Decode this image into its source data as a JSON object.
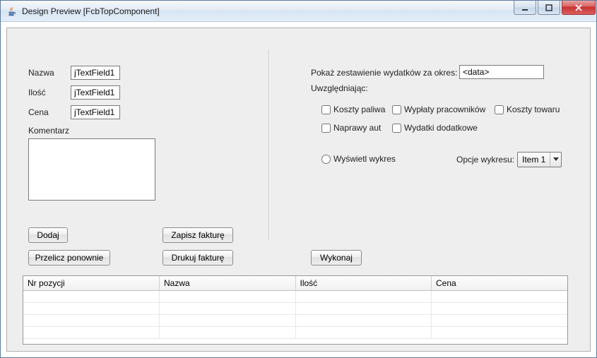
{
  "window": {
    "title": "Design Preview [FcbTopComponent]"
  },
  "left": {
    "labels": {
      "nazwa": "Nazwa",
      "ilosc": "Ilość",
      "cena": "Cena",
      "komentarz": "Komentarz"
    },
    "fields": {
      "nazwa": "jTextField1",
      "ilosc": "jTextField1",
      "cena": "jTextField1",
      "komentarz": ""
    },
    "buttons": {
      "dodaj": "Dodaj",
      "zapisz": "Zapisz fakturę",
      "przelicz": "Przelicz ponownie",
      "drukuj": "Drukuj fakturę"
    }
  },
  "right": {
    "period_label": "Pokaż zestawienie wydatków za okres:",
    "period_value": "<data>",
    "consider_label": "Uwzględniając:",
    "checks": {
      "paliwo": "Koszty paliwa",
      "wyplaty": "Wypłaty pracowników",
      "towar": "Koszty towaru",
      "naprawy": "Naprawy aut",
      "dodatkowe": "Wydatki dodatkowe"
    },
    "radio_wykres": "Wyświetl wykres",
    "opcje_label": "Opcje wykresu:",
    "opcje_selected": "Item 1",
    "wykonaj": "Wykonaj"
  },
  "table": {
    "headers": [
      "Nr pozycji",
      "Nazwa",
      "Ilość",
      "Cena"
    ],
    "rows": [
      [
        "",
        "",
        "",
        ""
      ],
      [
        "",
        "",
        "",
        ""
      ],
      [
        "",
        "",
        "",
        ""
      ],
      [
        "",
        "",
        "",
        ""
      ]
    ]
  }
}
